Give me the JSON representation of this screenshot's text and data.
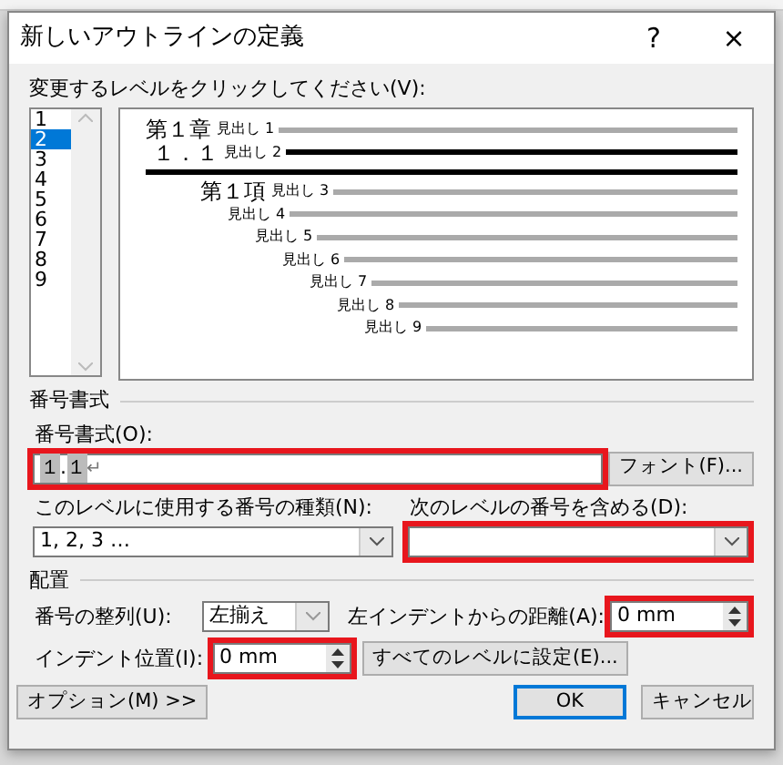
{
  "window": {
    "title": "新しいアウトラインの定義",
    "help": "?",
    "close": "×"
  },
  "level_prompt": "変更するレベルをクリックしてください(V):",
  "levels": [
    {
      "label": "1",
      "selected": false
    },
    {
      "label": "2",
      "selected": true
    },
    {
      "label": "3",
      "selected": false
    },
    {
      "label": "4",
      "selected": false
    },
    {
      "label": "5",
      "selected": false
    },
    {
      "label": "6",
      "selected": false
    },
    {
      "label": "7",
      "selected": false
    },
    {
      "label": "8",
      "selected": false
    },
    {
      "label": "9",
      "selected": false
    }
  ],
  "preview": [
    {
      "number": "第１章",
      "label": "見出し 1",
      "selected": false
    },
    {
      "number": "１．１",
      "label": "見出し 2",
      "selected": true
    },
    {
      "number": "第１項",
      "label": "見出し 3",
      "selected": false
    },
    {
      "label": "見出し 4",
      "selected": false
    },
    {
      "label": "見出し 5",
      "selected": false
    },
    {
      "label": "見出し 6",
      "selected": false
    },
    {
      "label": "見出し 7",
      "selected": false
    },
    {
      "label": "見出し 8",
      "selected": false
    },
    {
      "label": "見出し 9",
      "selected": false
    }
  ],
  "number_format": {
    "heading": "番号書式",
    "format_label": "番号書式(O):",
    "format_parts": [
      {
        "text": "１",
        "field": true
      },
      {
        "text": ".",
        "field": false
      },
      {
        "text": "１",
        "field": true
      }
    ],
    "end_mark": "↵",
    "format_highlighted": true,
    "font_button": "フォント(F)...",
    "style_label": "このレベルに使用する番号の種類(N):",
    "style_value": "1, 2, 3 …",
    "style_highlighted": false,
    "include_label": "次のレベルの番号を含める(D):",
    "include_highlighted": true
  },
  "position": {
    "heading": "配置",
    "alignment_label": "番号の整列(U):",
    "alignment_value": "左揃え",
    "distance_label": "左インデントからの距離(A):",
    "distance_value": "0 mm",
    "distance_highlighted": true,
    "indent_label": "インデント位置(I):",
    "indent_value": "0 mm",
    "indent_highlighted": true,
    "set_all_button": "すべてのレベルに設定(E)..."
  },
  "buttons": [
    {
      "label": "オプション(M) >>",
      "default": false
    },
    {
      "label": "OK",
      "default": true
    },
    {
      "label": "キャンセル",
      "default": false
    }
  ]
}
